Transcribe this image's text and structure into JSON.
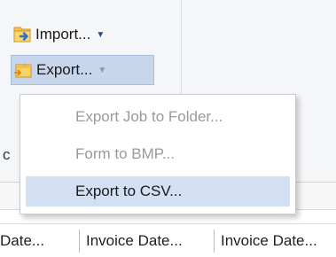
{
  "ribbon": {
    "import_label": "Import...",
    "export_label": "Export..."
  },
  "export_menu": {
    "items": [
      {
        "label": "Export Job to Folder...",
        "enabled": false
      },
      {
        "label": "Form to BMP...",
        "enabled": false
      },
      {
        "label": "Export to CSV...",
        "enabled": true,
        "highlighted": true
      }
    ]
  },
  "left_edge_text": "c",
  "grid": {
    "columns": [
      "Date...",
      "Invoice Date...",
      "Invoice Date..."
    ]
  },
  "colors": {
    "ribbon_bg": "#f5f6f8",
    "pressed_button": "#c8d6eb",
    "menu_highlight": "#d3e0f3",
    "disabled_text": "#9a9a9a"
  },
  "icons": {
    "import": "folder-import-icon",
    "export": "export-folder-icon"
  }
}
